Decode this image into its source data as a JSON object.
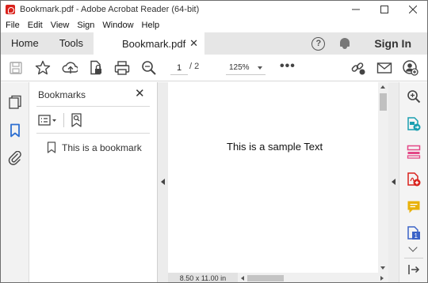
{
  "window": {
    "title": "Bookmark.pdf - Adobe Acrobat Reader (64-bit)",
    "controls": {
      "minimize": "—",
      "maximize": "☐",
      "close": "✕"
    }
  },
  "menu": [
    "File",
    "Edit",
    "View",
    "Sign",
    "Window",
    "Help"
  ],
  "tabs": {
    "home": "Home",
    "tools": "Tools",
    "document": "Bookmark.pdf",
    "close": "✕",
    "help": "?",
    "sign_in": "Sign In"
  },
  "toolbar": {
    "current_page": "1",
    "total_pages": "/ 2",
    "zoom": "125%",
    "more": "•••",
    "icons": [
      "save-icon",
      "star-icon",
      "cloud-upload-icon",
      "file-lock-icon",
      "print-icon",
      "zoom-search-icon",
      "link-icon",
      "mail-icon",
      "add-user-icon"
    ]
  },
  "left_rail": {
    "icons": [
      "pages-icon",
      "bookmark-icon",
      "attachment-icon"
    ]
  },
  "bookmarks": {
    "title": "Bookmarks",
    "close": "✕",
    "items": [
      {
        "label": "This is a bookmark"
      }
    ]
  },
  "document": {
    "text": "This is a sample Text",
    "page_size": "8.50 x 11.00 in"
  },
  "right_rail": {
    "icons": [
      "zoom-icon",
      "export-pdf-icon",
      "organize-pages-icon",
      "create-pdf-icon",
      "comment-icon",
      "scan-icon",
      "collapse-panel-icon"
    ]
  },
  "colors": {
    "accent_blue": "#2d6fd1",
    "adobe_red": "#d9221c",
    "comment_yellow": "#e8b10a",
    "export_teal": "#1a9fb0",
    "organize_pink": "#e34786",
    "scan_blue": "#3b63c7"
  }
}
